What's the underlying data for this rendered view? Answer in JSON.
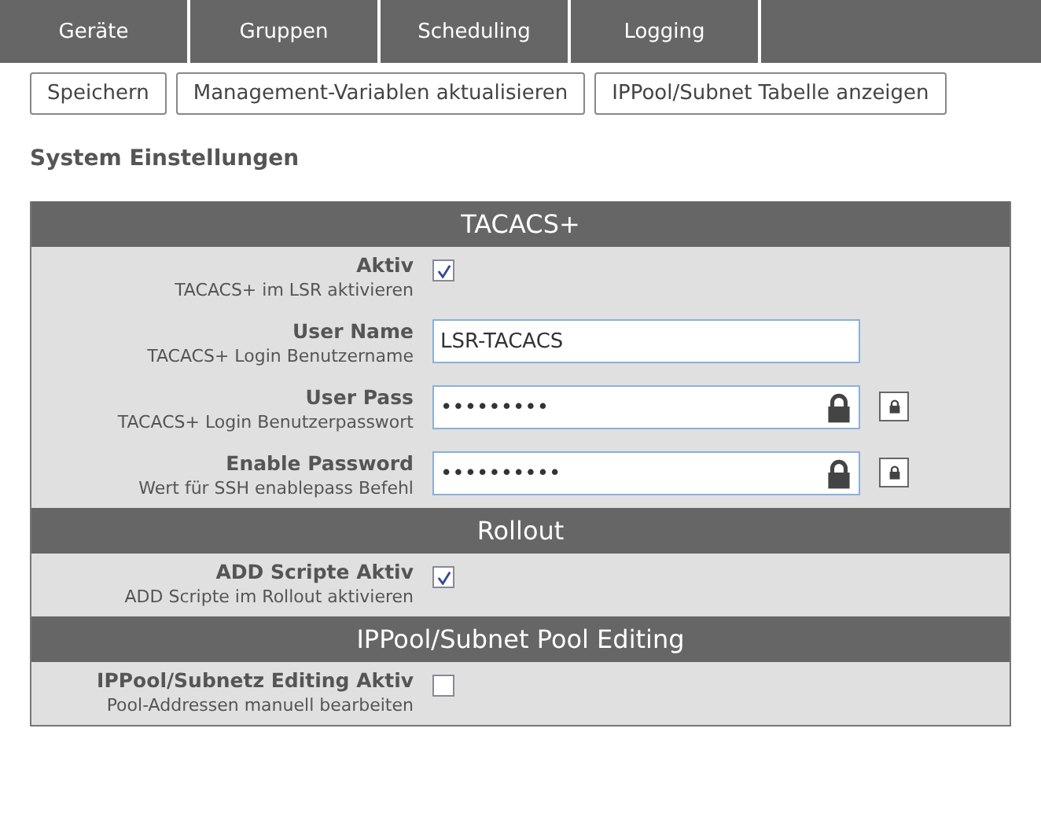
{
  "nav": {
    "tabs": [
      {
        "label": "Geräte",
        "selected": false
      },
      {
        "label": "Gruppen",
        "selected": false
      },
      {
        "label": "Scheduling",
        "selected": false
      },
      {
        "label": "Logging",
        "selected": false
      }
    ]
  },
  "toolbar": {
    "buttons": [
      "Speichern",
      "Management-Variablen aktualisieren",
      "IPPool/Subnet Tabelle anzeigen"
    ]
  },
  "heading": "System Einstellungen",
  "sections": [
    {
      "title": "TACACS+",
      "rows": [
        {
          "kind": "checkbox",
          "label": "Aktiv",
          "hint": "TACACS+ im LSR aktivieren",
          "checked": true
        },
        {
          "kind": "text",
          "label": "User Name",
          "hint": "TACACS+ Login Benutzername",
          "value": "LSR-TACACS"
        },
        {
          "kind": "password",
          "label": "User Pass",
          "hint": "TACACS+ Login Benutzerpasswort",
          "value": "•••••••••"
        },
        {
          "kind": "password",
          "label": "Enable Password",
          "hint": "Wert für SSH enablepass Befehl",
          "value": "••••••••••"
        }
      ]
    },
    {
      "title": "Rollout",
      "rows": [
        {
          "kind": "checkbox",
          "label": "ADD Scripte Aktiv",
          "hint": "ADD Scripte im Rollout aktivieren",
          "checked": true
        }
      ]
    },
    {
      "title": "IPPool/Subnet Pool Editing",
      "rows": [
        {
          "kind": "checkbox",
          "label": "IPPool/Subnetz Editing Aktiv",
          "hint": "Pool-Addressen manuell bearbeiten",
          "checked": false
        }
      ]
    }
  ]
}
